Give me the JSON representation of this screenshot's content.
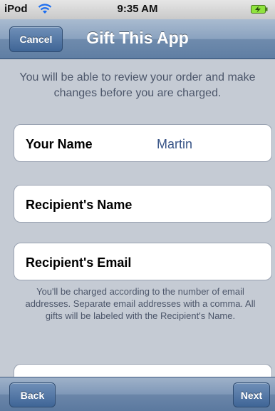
{
  "status_bar": {
    "carrier": "iPod",
    "time": "9:35 AM",
    "wifi_icon": "wifi-icon",
    "battery_icon": "battery-charging-icon"
  },
  "nav": {
    "title": "Gift This App",
    "cancel_label": "Cancel"
  },
  "intro_text": "You will be able to review your order and make changes before you are charged.",
  "form": {
    "your_name_label": "Your Name",
    "your_name_value": "Martin",
    "recipient_name_label": "Recipient's Name",
    "recipient_email_label": "Recipient's Email"
  },
  "email_note": "You'll be charged according to the number of email addresses. Separate email addresses with a comma. All gifts will be labeled with the Recipient's Name.",
  "toolbar": {
    "back_label": "Back",
    "next_label": "Next"
  },
  "colors": {
    "nav_blue": "#6f8bad",
    "background": "#c5cbd4",
    "value_blue": "#385487",
    "battery_green": "#8fe33d"
  }
}
